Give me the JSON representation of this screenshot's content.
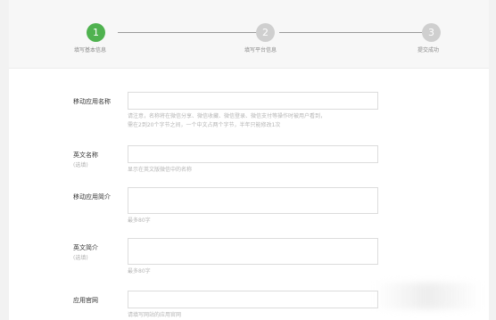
{
  "steps": [
    {
      "number": "1",
      "label": "填写基本信息",
      "state": "active"
    },
    {
      "number": "2",
      "label": "填写平台信息",
      "state": "inactive"
    },
    {
      "number": "3",
      "label": "提交成功",
      "state": "inactive"
    }
  ],
  "colors": {
    "active": "#4fb24f",
    "inactive": "#cfcfcf",
    "header_bg": "#f7f7f7"
  },
  "form": {
    "app_name": {
      "label": "移动应用名称",
      "value": "",
      "hint_line1": "请注意，名称将在微信分享、微信收藏、微信登录、微信支付等操作时被用户看到，",
      "hint_line2": "需在2到20个字节之间，一个中文占两个字节，半年只能修改1次"
    },
    "english_name": {
      "label": "英文名称",
      "sublabel": "(选填)",
      "value": "",
      "hint": "显示在英文版微信中的名称"
    },
    "app_intro": {
      "label": "移动应用简介",
      "value": "",
      "hint": "最多80字"
    },
    "english_intro": {
      "label": "英文简介",
      "sublabel": "(选填)",
      "value": "",
      "hint": "最多80字"
    },
    "website": {
      "label": "应用官网",
      "value": "",
      "hint": "请填写网站的应用官网"
    }
  }
}
